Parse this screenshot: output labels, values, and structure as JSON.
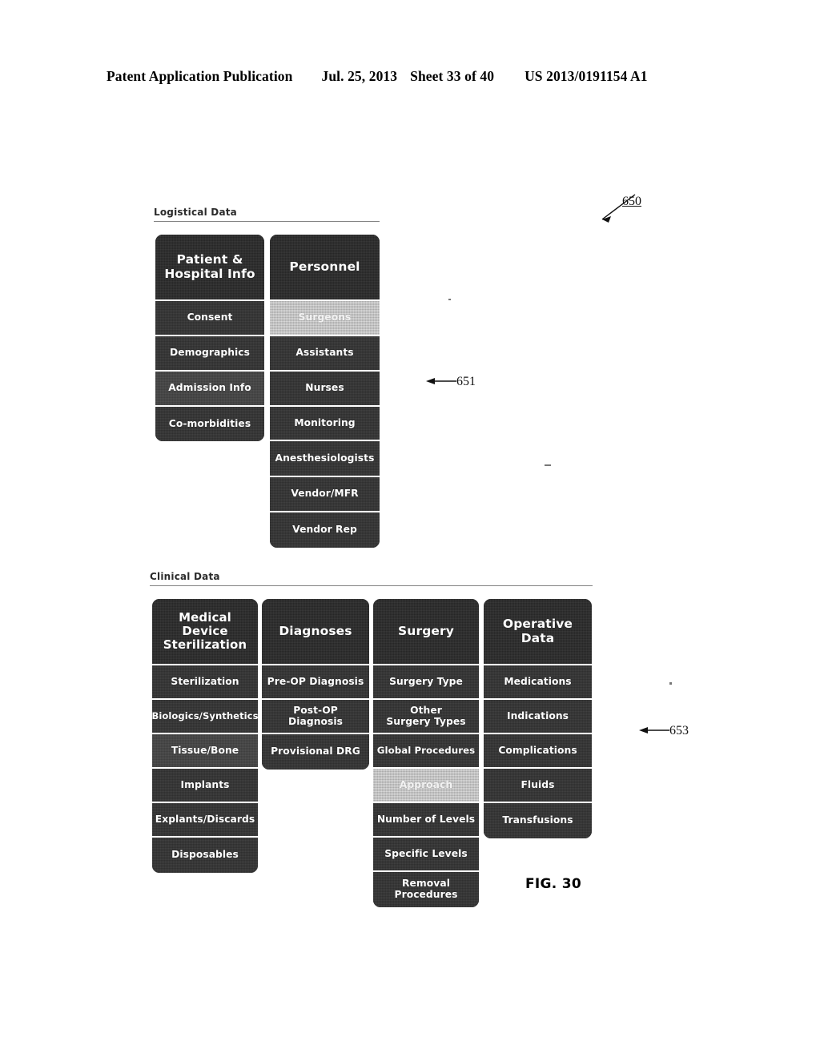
{
  "header": {
    "publication": "Patent Application Publication",
    "date": "Jul. 25, 2013",
    "sheet": "Sheet 33 of 40",
    "patent_number": "US 2013/0191154 A1"
  },
  "figure": {
    "label": "FIG. 30",
    "reference_numerals": [
      {
        "id": "650",
        "text": "650",
        "target": "overall-diagram"
      },
      {
        "id": "651",
        "text": "651",
        "target": "logistical-data-section"
      },
      {
        "id": "653",
        "text": "653",
        "target": "clinical-data-section"
      }
    ],
    "sections": [
      {
        "id": "logistical-data",
        "title": "Logistical Data",
        "columns": [
          {
            "id": "patient-hospital-info",
            "header": "Patient &\nHospital Info",
            "header_lines": [
              "Patient &",
              "Hospital Info"
            ],
            "items": [
              {
                "label": "Consent",
                "highlighted": false
              },
              {
                "label": "Demographics",
                "highlighted": false
              },
              {
                "label": "Admission Info",
                "highlighted": false
              },
              {
                "label": "Co-morbidities",
                "highlighted": false
              }
            ]
          },
          {
            "id": "personnel",
            "header": "Personnel",
            "header_lines": [
              "Personnel"
            ],
            "items": [
              {
                "label": "Surgeons",
                "highlighted": true
              },
              {
                "label": "Assistants",
                "highlighted": false
              },
              {
                "label": "Nurses",
                "highlighted": false
              },
              {
                "label": "Monitoring",
                "highlighted": false
              },
              {
                "label": "Anesthesiologists",
                "highlighted": false
              },
              {
                "label": "Vendor/MFR",
                "highlighted": false
              },
              {
                "label": "Vendor Rep",
                "highlighted": false
              }
            ]
          }
        ]
      },
      {
        "id": "clinical-data",
        "title": "Clinical Data",
        "columns": [
          {
            "id": "medical-device-sterilization",
            "header": "Medical Device\nSterilization",
            "header_lines": [
              "Medical Device",
              "Sterilization"
            ],
            "items": [
              {
                "label": "Sterilization",
                "highlighted": false
              },
              {
                "label": "Biologics/Synthetics",
                "highlighted": false
              },
              {
                "label": "Tissue/Bone",
                "highlighted": false
              },
              {
                "label": "Implants",
                "highlighted": false
              },
              {
                "label": "Explants/Discards",
                "highlighted": false
              },
              {
                "label": "Disposables",
                "highlighted": false
              }
            ]
          },
          {
            "id": "diagnoses",
            "header": "Diagnoses",
            "header_lines": [
              "Diagnoses"
            ],
            "items": [
              {
                "label": "Pre-OP Diagnosis",
                "highlighted": false
              },
              {
                "label": "Post-OP Diagnosis",
                "highlighted": false
              },
              {
                "label": "Provisional DRG",
                "highlighted": false
              }
            ]
          },
          {
            "id": "surgery",
            "header": "Surgery",
            "header_lines": [
              "Surgery"
            ],
            "items": [
              {
                "label": "Surgery Type",
                "highlighted": false
              },
              {
                "label": "Other\nSurgery Types",
                "highlighted": false
              },
              {
                "label": "Global Procedures",
                "highlighted": false
              },
              {
                "label": "Approach",
                "highlighted": true
              },
              {
                "label": "Number of Levels",
                "highlighted": false
              },
              {
                "label": "Specific Levels",
                "highlighted": false
              },
              {
                "label": "Removal\nProcedures",
                "highlighted": false
              }
            ]
          },
          {
            "id": "operative-data",
            "header": "Operative\nData",
            "header_lines": [
              "Operative",
              "Data"
            ],
            "items": [
              {
                "label": "Medications",
                "highlighted": false
              },
              {
                "label": "Indications",
                "highlighted": false
              },
              {
                "label": "Complications",
                "highlighted": false
              },
              {
                "label": "Fluids",
                "highlighted": false
              },
              {
                "label": "Transfusions",
                "highlighted": false
              }
            ]
          }
        ]
      }
    ]
  },
  "colors": {
    "cell_dark": "#2f2f2f",
    "cell_highlight": "#bfbfbf",
    "text_light": "#ffffff",
    "rule": "#6b6b6b",
    "page_background": "#ffffff"
  }
}
